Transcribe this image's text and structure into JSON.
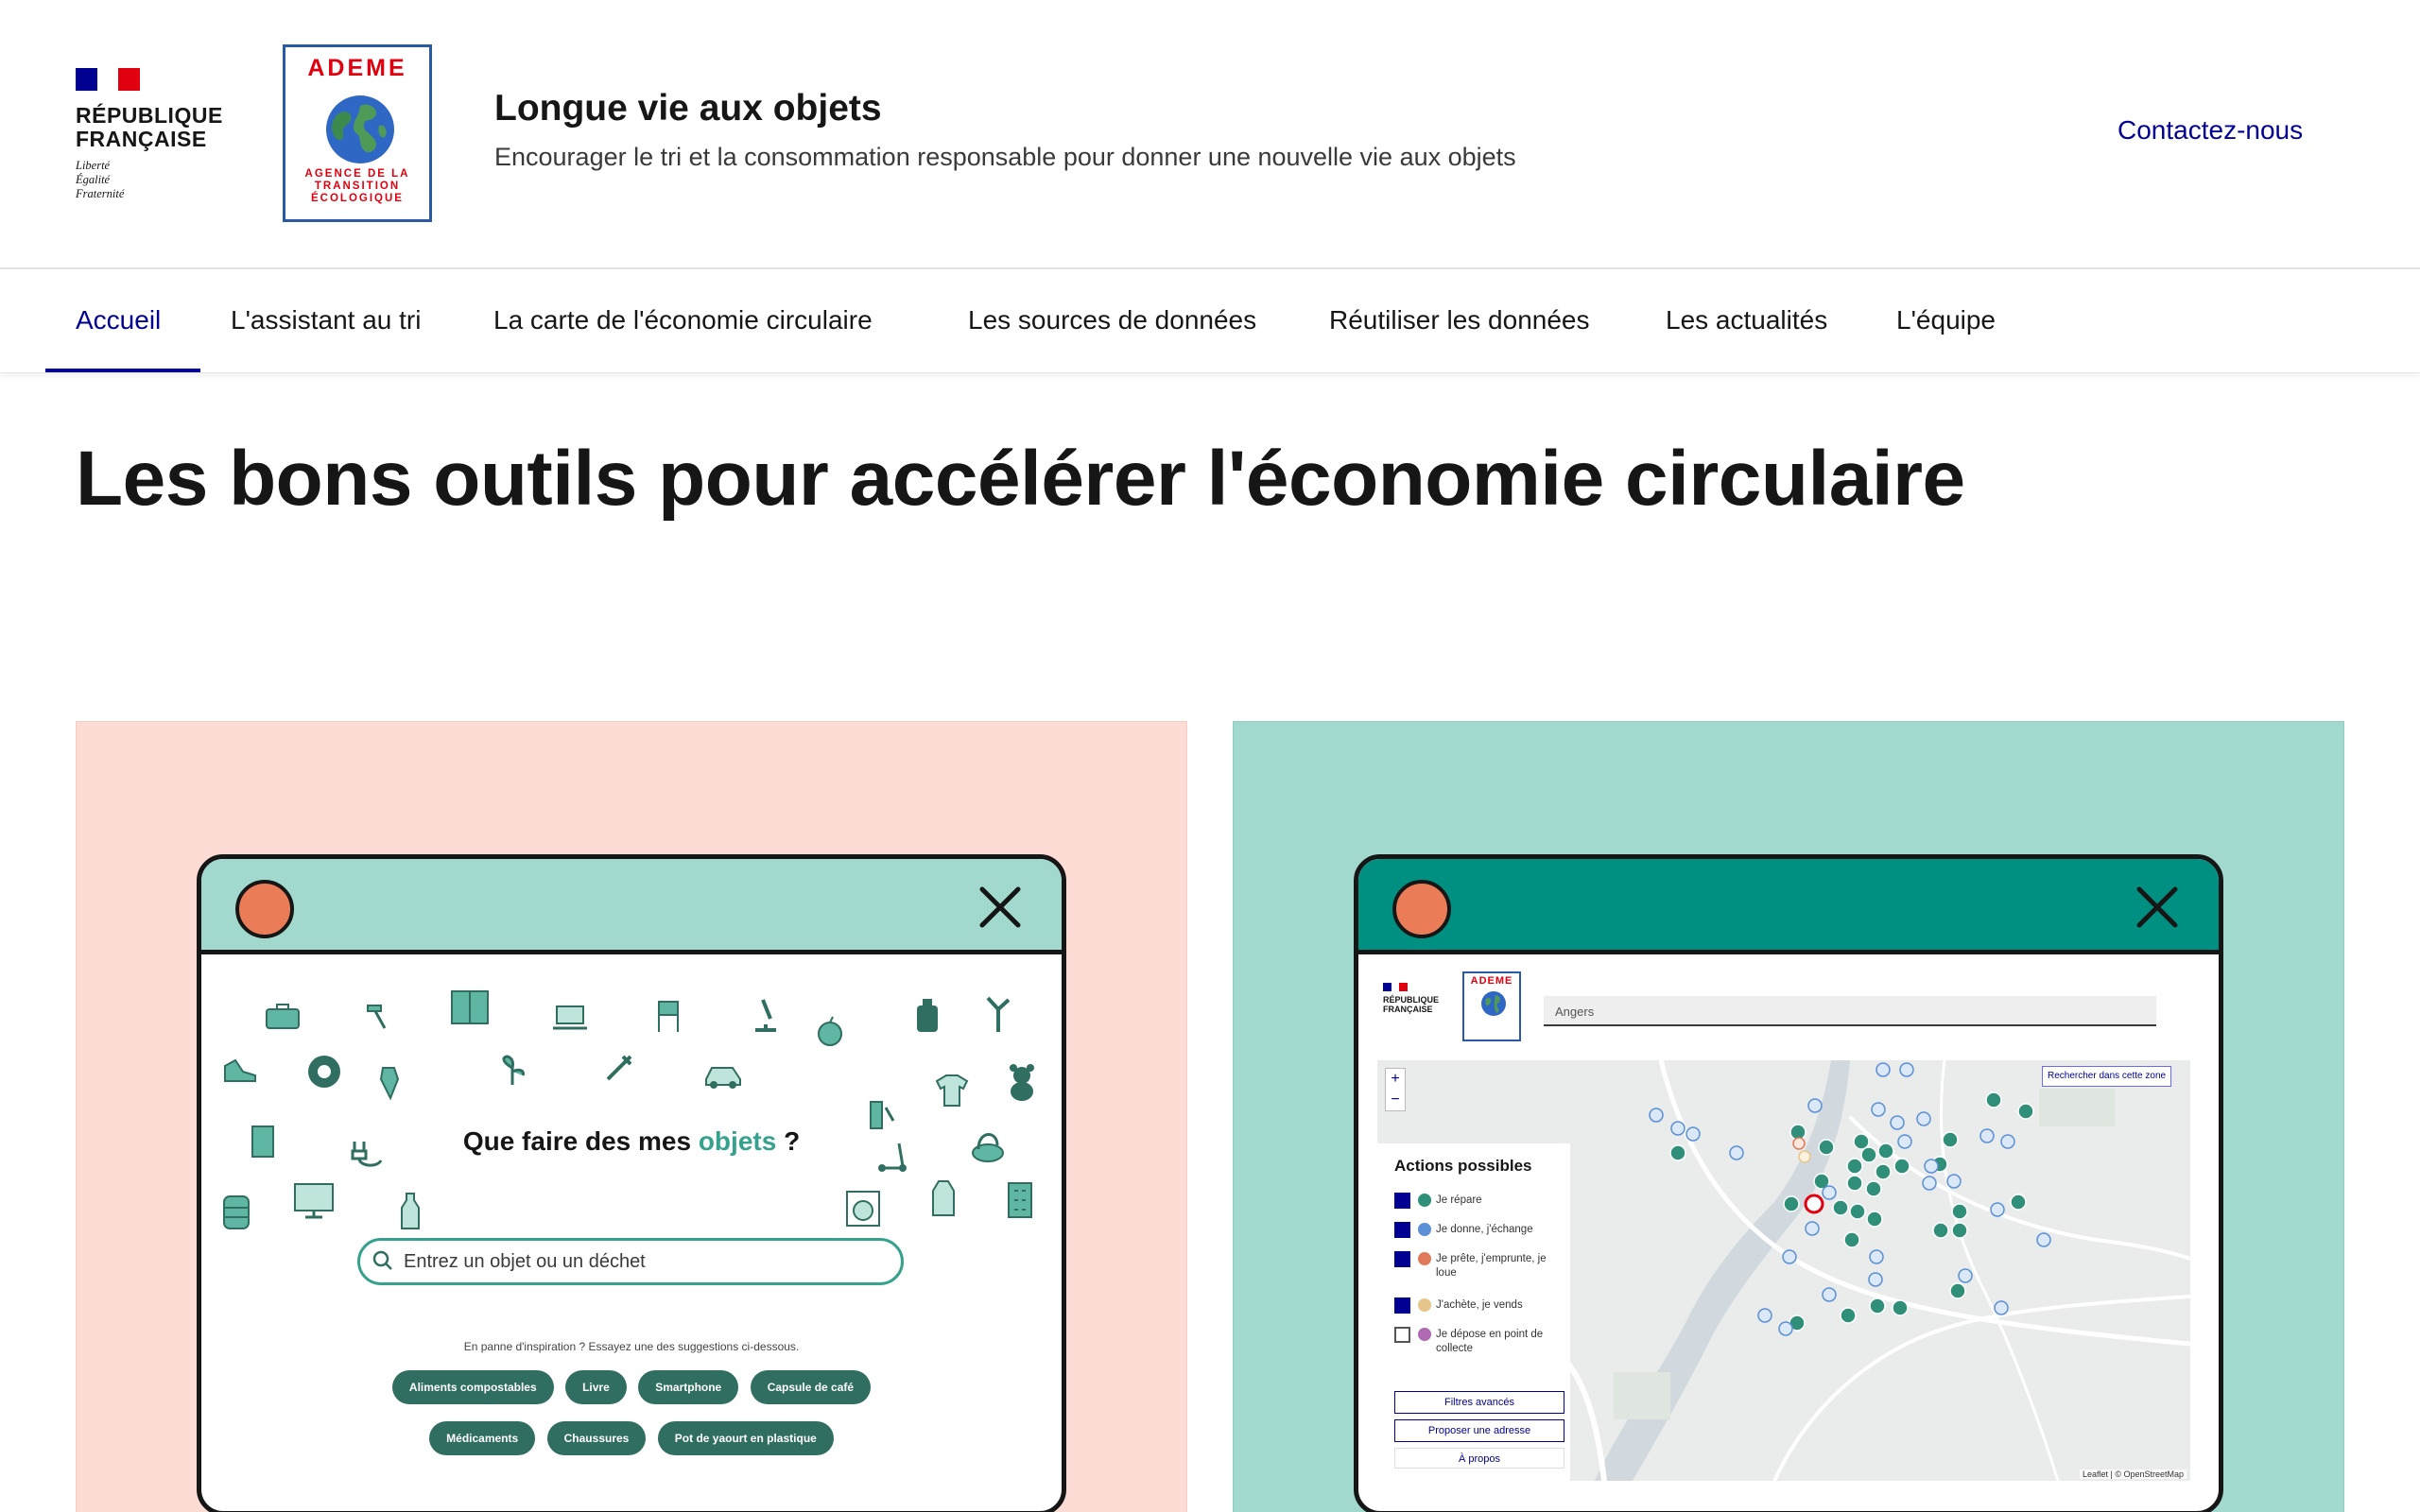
{
  "brand": {
    "republic_name": "RÉPUBLIQUE\nFRANÇAISE",
    "motto": "Liberté\nÉgalité\nFraternité",
    "ademe_wordmark": "ADEME",
    "ademe_subtitle": "AGENCE DE LA\nTRANSITION\nÉCOLOGIQUE",
    "flag_colors": [
      "#000091",
      "#ffffff",
      "#e1000f"
    ]
  },
  "site": {
    "title": "Longue vie aux objets",
    "tagline": "Encourager le tri et la consommation responsable pour donner une nouvelle vie aux objets"
  },
  "header": {
    "contact_label": "Contactez-nous"
  },
  "nav": {
    "items": [
      {
        "label": "Accueil",
        "active": true
      },
      {
        "label": "L'assistant au tri"
      },
      {
        "label": "La carte de l'économie circulaire"
      },
      {
        "label": "Les sources de données"
      },
      {
        "label": "Réutiliser les données"
      },
      {
        "label": "Les actualités"
      },
      {
        "label": "L'équipe"
      }
    ]
  },
  "main": {
    "heading": "Les bons outils pour accélérer l'économie circulaire"
  },
  "card_assistant": {
    "background": "#fddcd5",
    "window_bar_color": "#a2d9ce",
    "heading_prefix": "Que faire des mes ",
    "heading_accent": "objets",
    "heading_suffix": " ?",
    "search_placeholder": "Entrez un objet ou un déchet",
    "hint": "En panne d'inspiration ? Essayez une des suggestions ci-dessous.",
    "suggestions_row1": [
      "Aliments compostables",
      "Livre",
      "Smartphone",
      "Capsule de café"
    ],
    "suggestions_row2": [
      "Médicaments",
      "Chaussures",
      "Pot de yaourt en plastique"
    ]
  },
  "card_map": {
    "background": "#a2d9ce",
    "window_bar_color": "#009081",
    "republic_name": "RÉPUBLIQUE\nFRANÇAISE",
    "search_value": "Angers",
    "search_zone_label": "Rechercher dans cette zone",
    "zoom_in": "+",
    "zoom_out": "−",
    "actions_title": "Actions possibles",
    "actions": [
      {
        "label": "Je répare",
        "checked": true,
        "color": "#2f8f78"
      },
      {
        "label": "Je donne, j'échange",
        "checked": true,
        "color": "#5b8fd6"
      },
      {
        "label": "Je prête, j'emprunte, je loue",
        "checked": true,
        "color": "#e0785a"
      },
      {
        "label": "J'achète, je vends",
        "checked": true,
        "color": "#e6c58a"
      },
      {
        "label": "Je dépose en point de collecte",
        "checked": false,
        "color": "#b06ab3"
      }
    ],
    "filters_label": "Filtres avancés",
    "propose_label": "Proposer une adresse",
    "about_label": "À propos",
    "attribution": "Leaflet | © OpenStreetMap"
  }
}
